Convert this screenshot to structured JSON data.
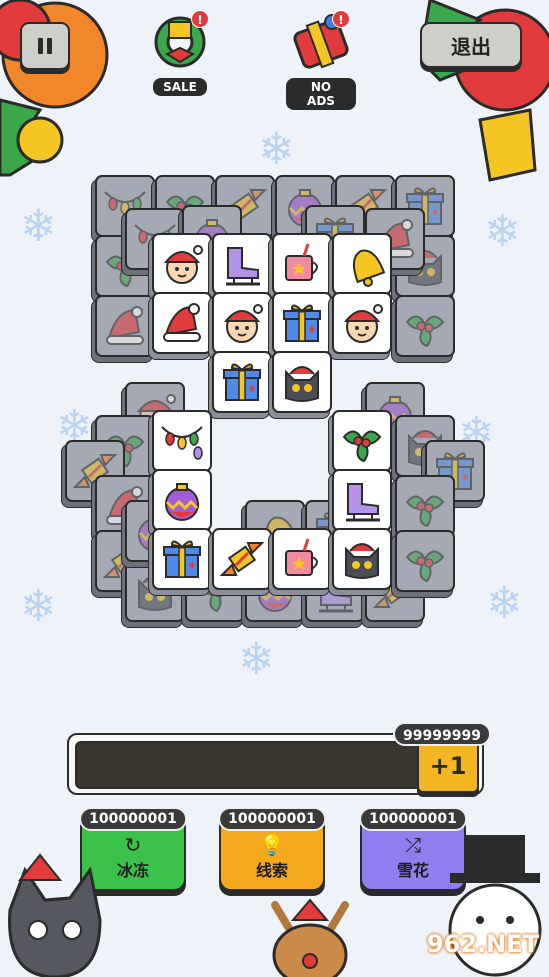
{
  "top_bar": {
    "exit_label": "退出",
    "promos": [
      {
        "label": "SALE",
        "badge": "!"
      },
      {
        "label": "NO ADS",
        "badge": "!"
      }
    ]
  },
  "slot_bar": {
    "plus_label": "+1",
    "coins": "99999999"
  },
  "powerups": [
    {
      "label": "冰冻",
      "count": "100000001",
      "color": "#3bc24a"
    },
    {
      "label": "线索",
      "count": "100000001",
      "color": "#f4a81e"
    },
    {
      "label": "雪花",
      "count": "100000001",
      "color": "#8e7ef0"
    }
  ],
  "watermark": "962.NET",
  "tiles": [
    "santa-girl",
    "ice-skate",
    "hot-cocoa",
    "golden-bell",
    "santa-hat",
    "santa-girl",
    "gift-box",
    "santa-girl",
    "gift-box",
    "black-cat",
    "string-lights",
    "holly",
    "ornament",
    "ice-skate",
    "gift-box",
    "candy-cracker",
    "hot-cocoa",
    "black-cat"
  ],
  "colors": {
    "background": "#eef2f9",
    "tile": "#ffffff",
    "tile_dim": "#a5a9b3",
    "accent": "#f3b623"
  }
}
